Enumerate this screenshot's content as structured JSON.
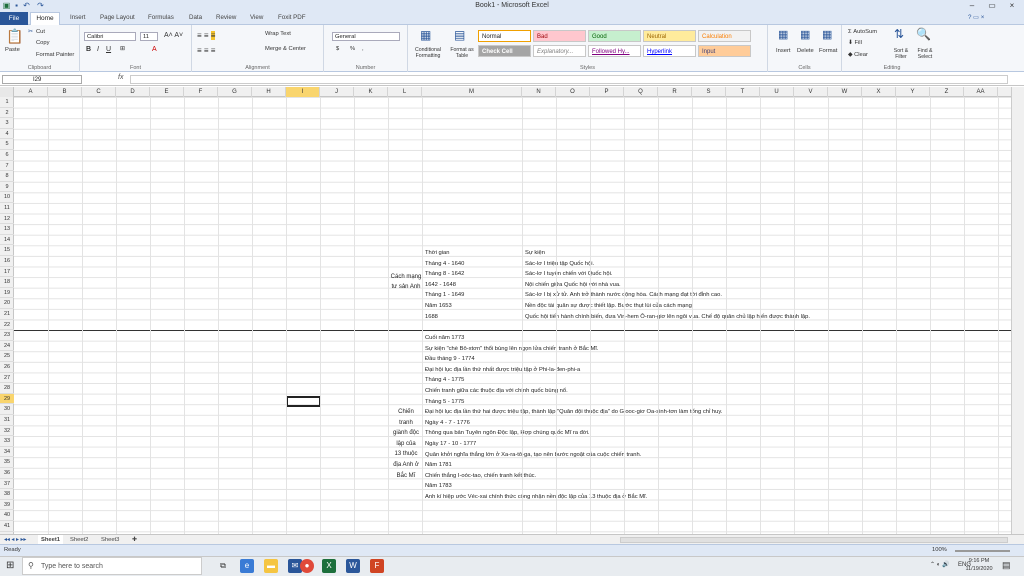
{
  "window": {
    "title": "Book1 - Microsoft Excel",
    "min": "–",
    "restore": "▭",
    "close": "×"
  },
  "tabs": [
    "File",
    "Home",
    "Insert",
    "Page Layout",
    "Formulas",
    "Data",
    "Review",
    "View",
    "Foxit PDF"
  ],
  "ribbon": {
    "clipboard": {
      "paste": "Paste",
      "cut": "Cut",
      "copy": "Copy",
      "painter": "Format Painter",
      "label": "Clipboard"
    },
    "font": {
      "name": "Calibri",
      "size": "11",
      "label": "Font"
    },
    "alignment": {
      "wrap": "Wrap Text",
      "merge": "Merge & Center",
      "label": "Alignment"
    },
    "number": {
      "format": "General",
      "currency": "$",
      "percent": "%",
      "comma": ",",
      "label": "Number"
    },
    "styles": {
      "cond": "Conditional Formatting",
      "fmt": "Format as Table",
      "normal": "Normal",
      "bad": "Bad",
      "good": "Good",
      "neutral": "Neutral",
      "calculation": "Calculation",
      "check": "Check Cell",
      "explanatory": "Explanatory...",
      "followed": "Followed Hy...",
      "hyperlink": "Hyperlink",
      "input": "Input",
      "label": "Styles"
    },
    "cells": {
      "insert": "Insert",
      "delete": "Delete",
      "format": "Format",
      "label": "Cells"
    },
    "editing": {
      "autosum": "AutoSum",
      "fill": "Fill",
      "clear": "Clear",
      "sort": "Sort & Filter",
      "find": "Find & Select",
      "label": "Editing"
    }
  },
  "namebox": "I29",
  "fx": "fx",
  "columns": [
    "A",
    "B",
    "C",
    "D",
    "E",
    "F",
    "G",
    "H",
    "I",
    "J",
    "K",
    "L",
    "M",
    "N",
    "O",
    "P",
    "Q",
    "R",
    "S",
    "T",
    "U",
    "V",
    "W",
    "X",
    "Y",
    "Z",
    "AA"
  ],
  "rows": [
    "1",
    "2",
    "3",
    "4",
    "5",
    "6",
    "7",
    "8",
    "9",
    "10",
    "11",
    "12",
    "13",
    "14",
    "15",
    "16",
    "17",
    "18",
    "19",
    "20",
    "21",
    "22",
    "23",
    "24",
    "25",
    "26",
    "27",
    "28",
    "29",
    "30",
    "31",
    "32",
    "33",
    "34",
    "35",
    "36",
    "37",
    "38",
    "39",
    "40",
    "41"
  ],
  "table1": {
    "label": "Cách mạng tư sản Anh",
    "header": {
      "time": "Thời gian",
      "event": "Sự kiện"
    },
    "rows": [
      {
        "time": "Tháng 4 - 1640",
        "event": "Sác-lơ I triệu tập Quốc hội."
      },
      {
        "time": "Tháng 8 - 1642",
        "event": "Sác-lơ I tuyên chiến với Quốc hội."
      },
      {
        "time": "1642 - 1648",
        "event": "Nội chiến giữa Quốc hội với nhà vua."
      },
      {
        "time": "Tháng 1 - 1649",
        "event": "Sác-lơ I bị xử tử. Anh trở thành nước cộng hòa. Cách mạng đạt tới đỉnh cao."
      },
      {
        "time": "Năm 1653",
        "event": "Nền độc tài quân sự được thiết lập. Bước thụt lùi của cách mạng."
      },
      {
        "time": "1688",
        "event": "Quốc hội tiến hành chính biến, đưa Vin-hem Ô-ran-giơ lên ngôi vua. Chế độ quân chủ lập hiến được thành lập."
      }
    ]
  },
  "table2": {
    "label": [
      "Chiến",
      "tranh",
      "giành độc",
      "lập của",
      "13 thuộc",
      "địa Anh ở",
      "Bắc Mĩ"
    ],
    "lines": [
      "Cuối năm 1773",
      "Sự kiện \"chè Bô-xtơn\" thổi bùng lên ngọn lửa chiến tranh ở Bắc Mĩ.",
      "Đầu tháng 9 - 1774",
      "Đại hội lục địa lần thứ nhất được triệu tập ở Phi-la-đen-phi-a",
      "Tháng 4 - 1775",
      "Chiến tranh giữa các thuộc địa với chính quốc bùng nổ.",
      "Tháng 5 - 1775",
      "Đại hội lục địa lần thứ hai được triệu tập, thành lập \"Quân đội thuộc địa\" do Giooc-giơ Oa-sinh-tơn làm tổng chỉ huy.",
      "Ngày 4 - 7 - 1776",
      "Thông qua bản Tuyên ngôn Độc lập, Hợp chúng quốc Mĩ ra đời.",
      "Ngày 17 - 10 - 1777",
      "Quân khởi nghĩa thắng lớn ở Xa-ra-tô-ga, tạo nên bước ngoặt của cuộc chiến tranh.",
      "Năm 1781",
      "Chiến thắng I-oóc-tao, chiến tranh kết thúc.",
      "Năm 1783",
      "Anh kí hiệp ước Véc-xai chính thức công nhận nền độc lập của 13 thuộc địa ở Bắc Mĩ."
    ]
  },
  "sheets": [
    "Sheet1",
    "Sheet2",
    "Sheet3"
  ],
  "status": {
    "ready": "Ready",
    "zoom": "100%"
  },
  "taskbar": {
    "search": "Type here to search",
    "time": "9:16 PM",
    "date": "11/19/2020",
    "lang": "ENG"
  },
  "colors": {
    "file_tab": "#2a5699",
    "excel_green": "#1d6f3c"
  }
}
